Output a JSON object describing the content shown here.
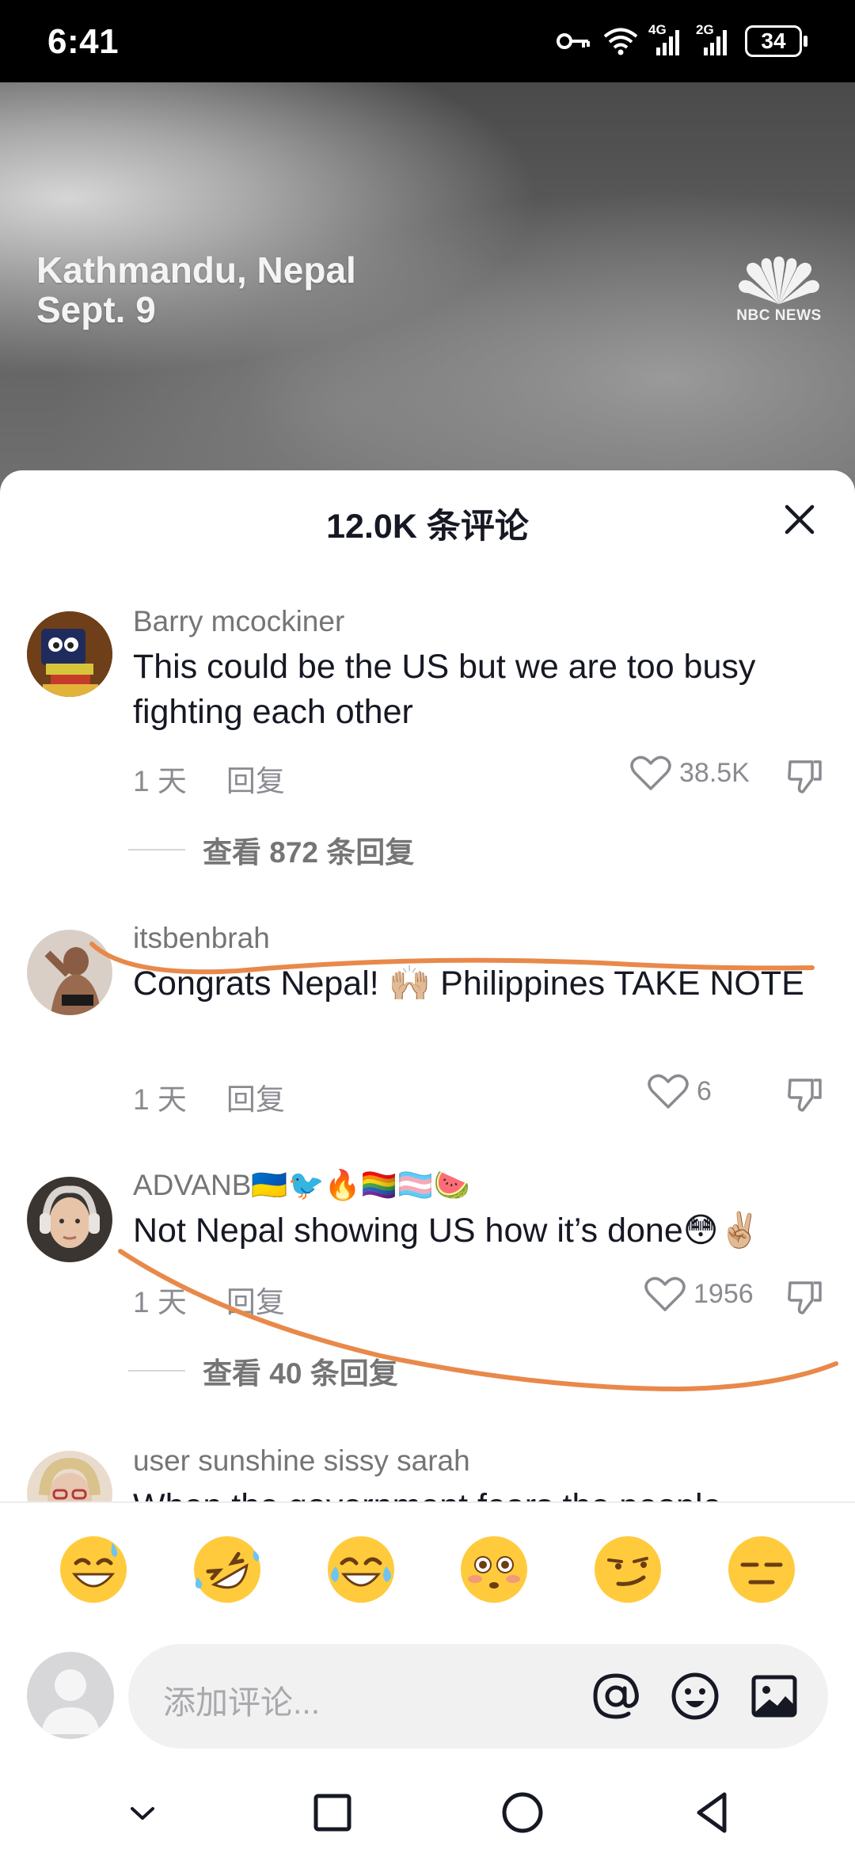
{
  "status_bar": {
    "time": "6:41",
    "net1": "4G",
    "net2": "2G",
    "battery": "34",
    "icons": [
      "key-icon",
      "wifi-icon",
      "signal-icon",
      "signal-icon",
      "battery-icon"
    ]
  },
  "video": {
    "caption_line1": "Kathmandu, Nepal",
    "caption_line2": "Sept. 9",
    "logo_text": "NBC NEWS"
  },
  "sheet": {
    "title": "12.0K 条评论",
    "close_icon": "close-icon"
  },
  "comments": [
    {
      "username": "Barry mcockiner",
      "text": "This could be the US but we are too busy fighting each other",
      "time": "1 天",
      "reply_label": "回复",
      "likes": "38.5K",
      "view_replies": "查看 872 条回复"
    },
    {
      "username": "itsbenbrah",
      "text": "Congrats Nepal! 🙌🏼 Philippines TAKE NOTE",
      "time": "1 天",
      "reply_label": "回复",
      "likes": "6"
    },
    {
      "username": "ADVANB🇺🇦🐦🔥🏳️‍🌈🏳️‍⚧️🍉",
      "text": "Not Nepal showing US how it’s done😳✌🏼",
      "time": "1 天",
      "reply_label": "回复",
      "likes": "1956",
      "view_replies": "查看 40 条回复"
    },
    {
      "username": "user sunshine sissy sarah",
      "text": "When the government fears the people"
    }
  ],
  "emoji_bar": [
    "sweat-smile-emoji",
    "rofl-emoji",
    "joy-emoji",
    "flushed-emoji",
    "smirk-emoji",
    "expressionless-emoji"
  ],
  "input": {
    "placeholder": "添加评论...",
    "icons": [
      "at-icon",
      "emoji-icon",
      "image-icon"
    ]
  },
  "nav": [
    "collapse-icon",
    "recents-icon",
    "home-icon",
    "back-icon"
  ],
  "colors": {
    "annotation": "#E8894A",
    "text_primary": "#161823",
    "text_secondary": "#8A8B91",
    "emoji_yellow": "#FFCB3D"
  }
}
